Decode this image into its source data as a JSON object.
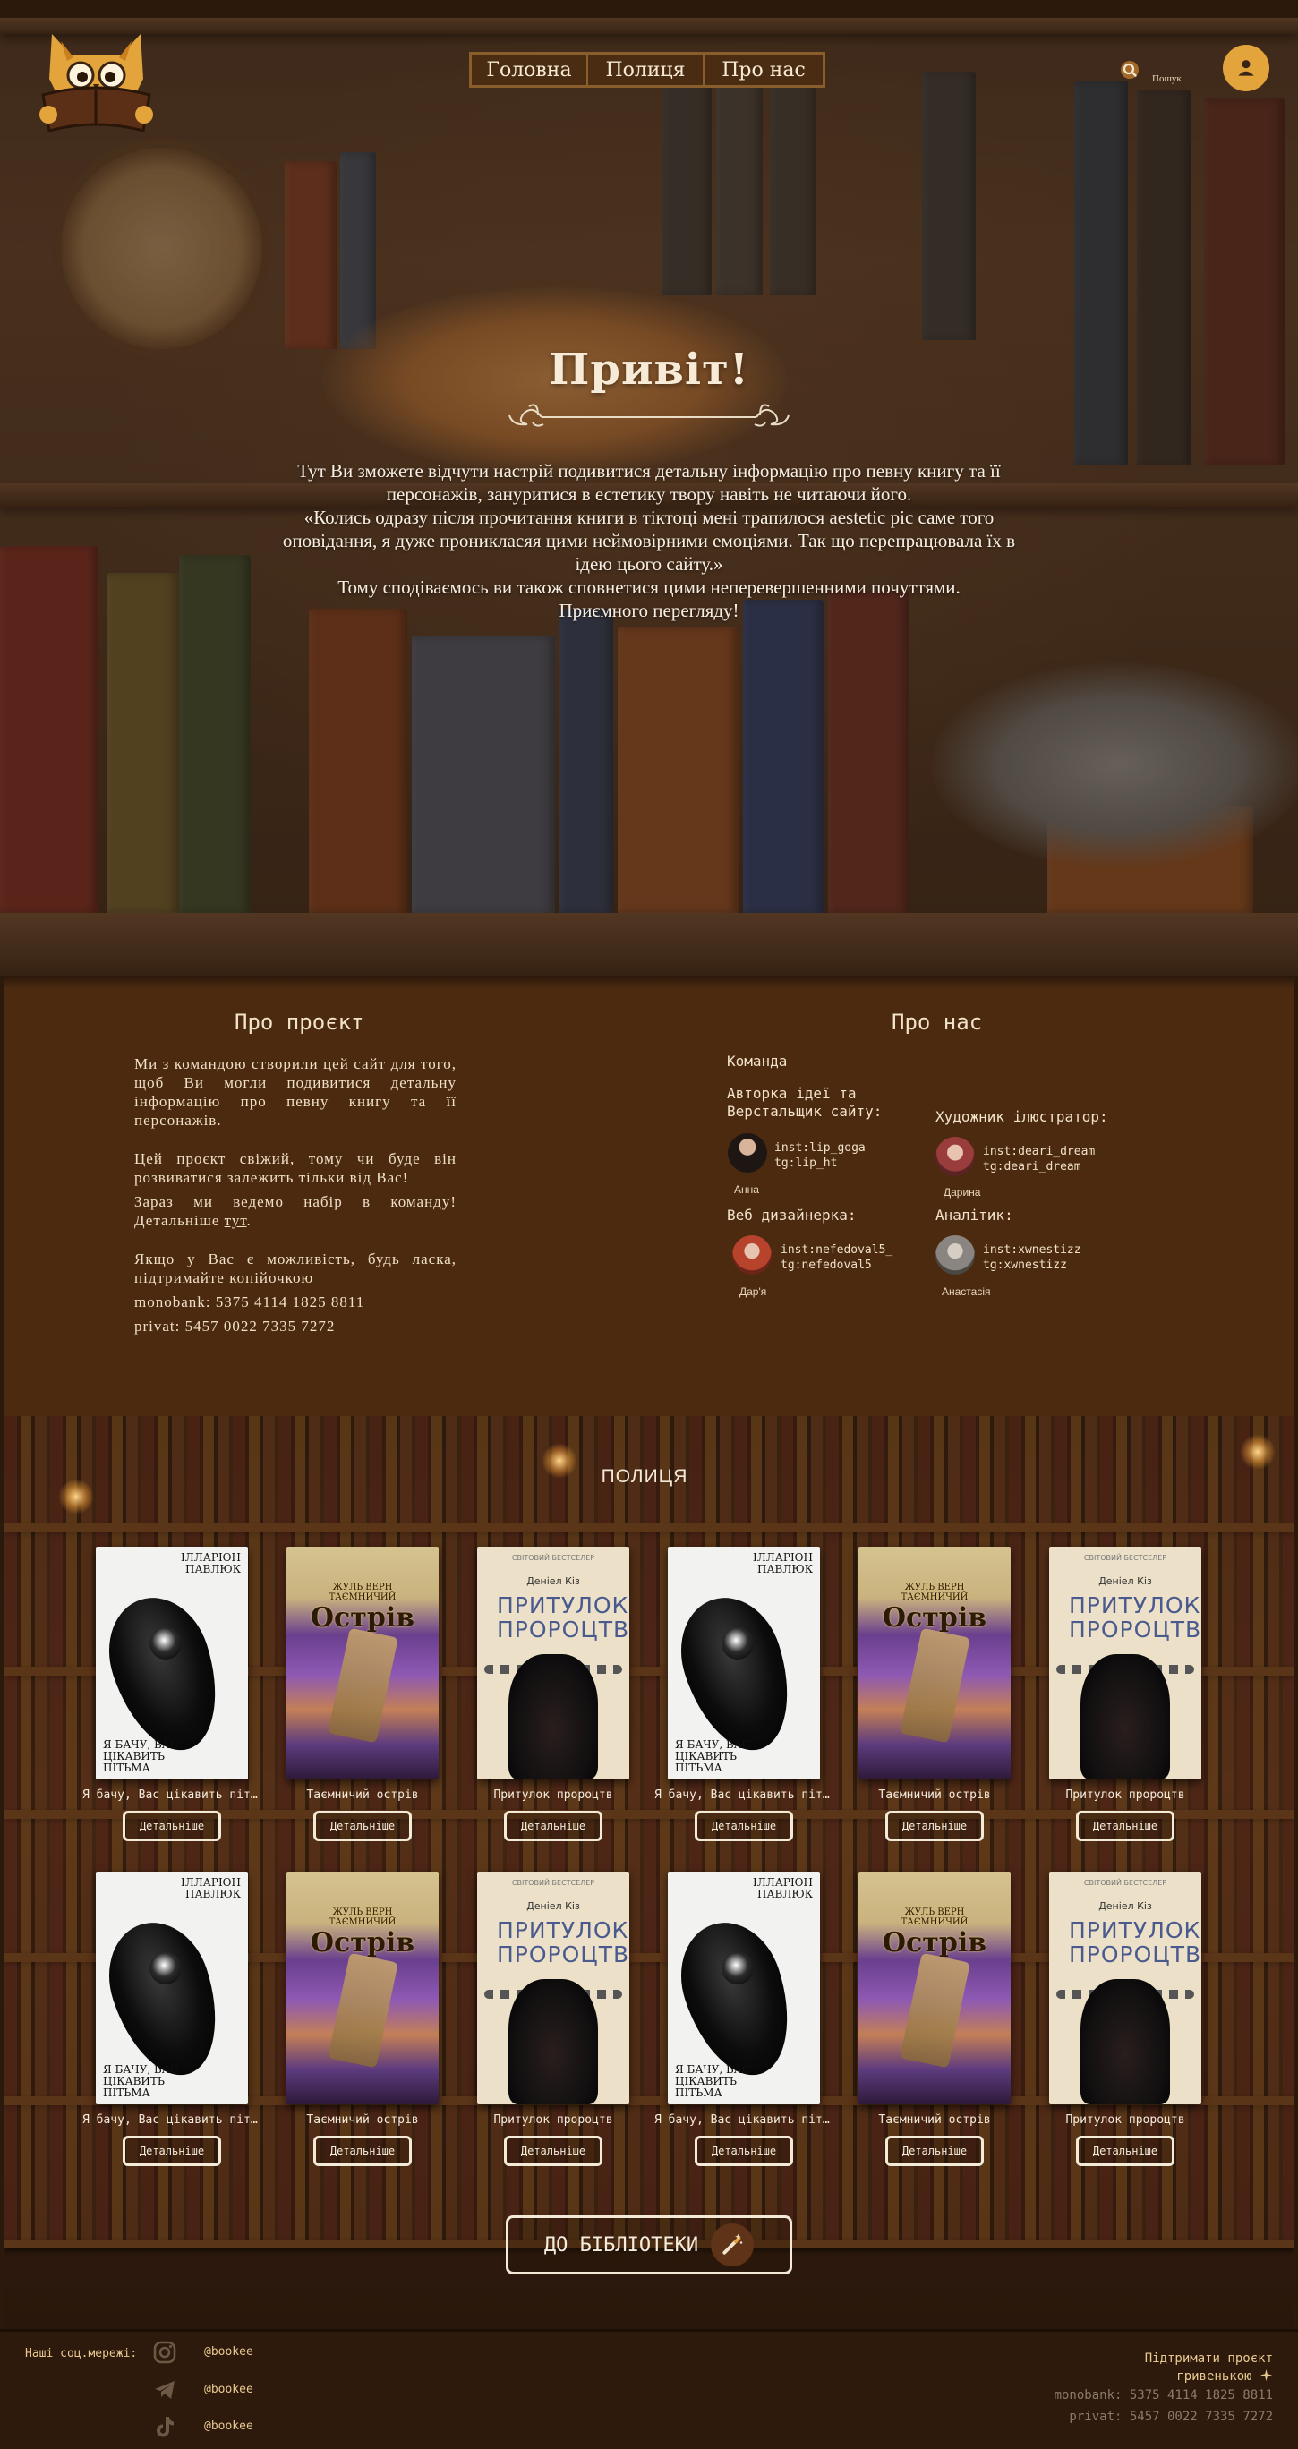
{
  "header": {
    "nav": [
      "Головна",
      "Полиця",
      "Про нас"
    ],
    "search_label": "Пошук"
  },
  "hero": {
    "title": "Привіт!",
    "lines": [
      "Тут Ви зможете відчути настрій подивитися детальну інформацію про певну книгу та її персонажів, зануритися в естетику твору навіть не читаючи його.",
      "«Колись одразу після прочитання книги в тіктоці мені трапилося aestetic pic саме того оповідання, я дуже проникласяя цими неймовірними емоціями. Так що перепрацювала їх в ідею цього сайту.»",
      "Тому сподіваємось ви також сповнетися цими неперевершенними почуттями.",
      "Приємного перегляду!"
    ]
  },
  "about_project": {
    "title": "Про проєкт",
    "p1": "Ми з командою створили цей сайт для того, щоб Ви могли подивитися детальну інформацію про певну книгу та її персонажів.",
    "p2": "Цей проєкт свіжий, тому чи буде він розвиватися залежить тільки від Вас!",
    "p3_text": "Зараз ми ведемо набір в команду! Детальніше ",
    "p3_link": "тут",
    "p3_end": ".",
    "p4": "Якщо у Вас є можливість, будь ласка, підтримайте копійочкою",
    "mono": "monobank: 5375 4114 1825 8811",
    "privat": "privat: 5457 0022 7335 7272"
  },
  "about_us": {
    "title": "Про нас",
    "team_label": "Команда",
    "members": [
      {
        "role": "Авторка ідеї та Верстальщик сайту:",
        "inst": "inst:lip_goga",
        "tg": "tg:lip_ht",
        "name": "Анна"
      },
      {
        "role": "Художник ілюстратор:",
        "inst": "inst:deari_dream",
        "tg": "tg:deari_dream",
        "name": "Дарина"
      },
      {
        "role": "Веб дизайнерка:",
        "inst": "inst:nefedoval5_",
        "tg": "tg:nefedoval5",
        "name": "Дар'я"
      },
      {
        "role": "Аналітик:",
        "inst": "inst:xwnestizz",
        "tg": "tg:xwnestizz",
        "name": "Анастасія"
      }
    ]
  },
  "shelf": {
    "title": "ПОЛИЦЯ",
    "details_label": "Детальніше",
    "books": [
      {
        "title": "Я бачу, Вас цікавить пітьма",
        "cover": "black",
        "author": "ІЛЛАРІОН ПАВЛЮК",
        "cover_title": "Я БАЧУ, ВАС ЦІКАВИТЬ ПІТЬМА"
      },
      {
        "title": "Таємничий острів",
        "cover": "island",
        "author": "ЖУЛЬ ВЕРН",
        "cover_title": "Острів",
        "cover_top": "ТАЄМНИЧИЙ"
      },
      {
        "title": "Притулок пророцтв",
        "cover": "refuge",
        "author": "Деніел Кіз",
        "cover_title": "ПРИТУЛОК ПРОРОЦТВ",
        "cover_top": "СВІТОВИЙ БЕСТСЕЛЕР"
      },
      {
        "title": "Я бачу, Вас цікавить пітьма",
        "cover": "black",
        "author": "ІЛЛАРІОН ПАВЛЮК",
        "cover_title": "Я БАЧУ, ВАС ЦІКАВИТЬ ПІТЬМА"
      },
      {
        "title": "Таємничий острів",
        "cover": "island",
        "author": "ЖУЛЬ ВЕРН",
        "cover_title": "Острів",
        "cover_top": "ТАЄМНИЧИЙ"
      },
      {
        "title": "Притулок пророцтв",
        "cover": "refuge",
        "author": "Деніел Кіз",
        "cover_title": "ПРИТУЛОК ПРОРОЦТВ",
        "cover_top": "СВІТОВИЙ БЕСТСЕЛЕР"
      },
      {
        "title": "Я бачу, Вас цікавить пітьма",
        "cover": "black",
        "author": "ІЛЛАРІОН ПАВЛЮК",
        "cover_title": "Я БАЧУ, ВАС ЦІКАВИТЬ ПІТЬМА"
      },
      {
        "title": "Таємничий острів",
        "cover": "island",
        "author": "ЖУЛЬ ВЕРН",
        "cover_title": "Острів",
        "cover_top": "ТАЄМНИЧИЙ"
      },
      {
        "title": "Притулок пророцтв",
        "cover": "refuge",
        "author": "Деніел Кіз",
        "cover_title": "ПРИТУЛОК ПРОРОЦТВ",
        "cover_top": "СВІТОВИЙ БЕСТСЕЛЕР"
      },
      {
        "title": "Я бачу, Вас цікавить пітьма",
        "cover": "black",
        "author": "ІЛЛАРІОН ПАВЛЮК",
        "cover_title": "Я БАЧУ, ВАС ЦІКАВИТЬ ПІТЬМА"
      },
      {
        "title": "Таємничий острів",
        "cover": "island",
        "author": "ЖУЛЬ ВЕРН",
        "cover_title": "Острів",
        "cover_top": "ТАЄМНИЧИЙ"
      },
      {
        "title": "Притулок пророцтв",
        "cover": "refuge",
        "author": "Деніел Кіз",
        "cover_title": "ПРИТУЛОК ПРОРОЦТВ",
        "cover_top": "СВІТОВИЙ БЕСТСЕЛЕР"
      }
    ],
    "library_button": "ДО БІБЛІОТЕКИ"
  },
  "footer": {
    "socials_label": "Наші соц.мережі:",
    "socials": [
      {
        "icon": "instagram-icon",
        "handle": "@bookee"
      },
      {
        "icon": "telegram-icon",
        "handle": "@bookee"
      },
      {
        "icon": "tiktok-icon",
        "handle": "@bookee"
      }
    ],
    "support_line1": "Підтримати проєкт",
    "support_line2": "гривенькою",
    "mono": "monobank: 5375 4114 1825 8811",
    "privat": "privat: 5457 0022 7335 7272"
  },
  "colors": {
    "accent": "#e3a43c",
    "nav_border": "#8a5d2c",
    "about_bg": "#4b2a0f",
    "footer_bg": "#2d1a0c",
    "footer_text": "#e8c890"
  }
}
